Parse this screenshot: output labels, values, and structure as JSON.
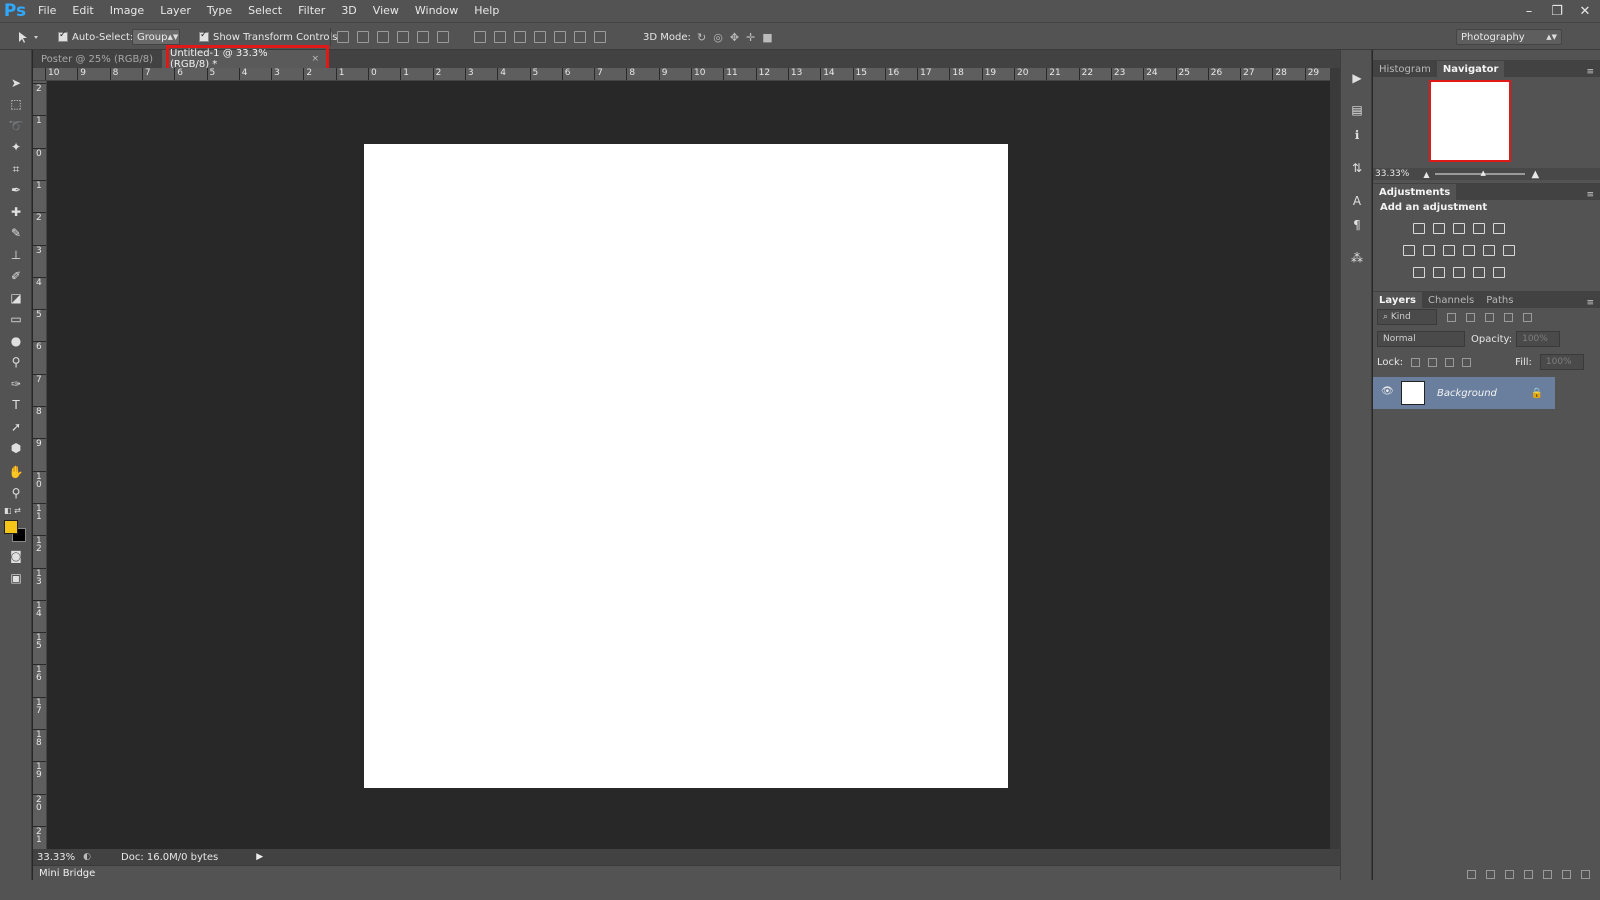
{
  "app": {
    "logo": "Ps"
  },
  "menu": [
    "File",
    "Edit",
    "Image",
    "Layer",
    "Type",
    "Select",
    "Filter",
    "3D",
    "View",
    "Window",
    "Help"
  ],
  "window_controls": {
    "minimize": "–",
    "restore": "❐",
    "close": "✕"
  },
  "options_bar": {
    "auto_select_label": "Auto-Select:",
    "auto_select_value": "Group",
    "show_transform_label": "Show Transform Controls",
    "mode_3d_label": "3D Mode:",
    "workspace": "Photography"
  },
  "tabs": [
    {
      "label": "Poster @ 25% (RGB/8)",
      "close": "×",
      "active": false
    },
    {
      "label": "Untitled-1 @ 33.3% (RGB/8) *",
      "close": "×",
      "active": true
    }
  ],
  "rulers": {
    "h_labels": [
      "10",
      "9",
      "8",
      "7",
      "6",
      "5",
      "4",
      "3",
      "2",
      "1",
      "0",
      "1",
      "2",
      "3",
      "4",
      "5",
      "6",
      "7",
      "8",
      "9",
      "10",
      "11",
      "12",
      "13",
      "14",
      "15",
      "16",
      "17",
      "18",
      "19",
      "20",
      "21",
      "22",
      "23",
      "24",
      "25",
      "26",
      "27",
      "28",
      "29"
    ],
    "v_labels": [
      "2",
      "1",
      "0",
      "1",
      "2",
      "3",
      "4",
      "5",
      "6",
      "7",
      "8",
      "9",
      "10",
      "11",
      "12",
      "13",
      "14",
      "15",
      "16",
      "17",
      "18",
      "19",
      "20",
      "21"
    ]
  },
  "status": {
    "zoom": "33.33%",
    "doc": "Doc: 16.0M/0 bytes"
  },
  "mini_bridge": "Mini Bridge",
  "panels": {
    "nav_tabs": [
      "Histogram",
      "Navigator"
    ],
    "nav_zoom": "33.33%",
    "adjustments_tab": "Adjustments",
    "add_adjustment": "Add an adjustment",
    "layer_tabs": [
      "Layers",
      "Channels",
      "Paths"
    ],
    "kind_filter": "Kind",
    "blend_mode": "Normal",
    "opacity_label": "Opacity:",
    "opacity_value": "100%",
    "lock_label": "Lock:",
    "fill_label": "Fill:",
    "fill_value": "100%",
    "layer_name": "Background"
  },
  "colors": {
    "foreground": "#f5c518",
    "background": "#000000",
    "accent_highlight": "#e01818",
    "selected_layer": "#6a7f9d"
  }
}
